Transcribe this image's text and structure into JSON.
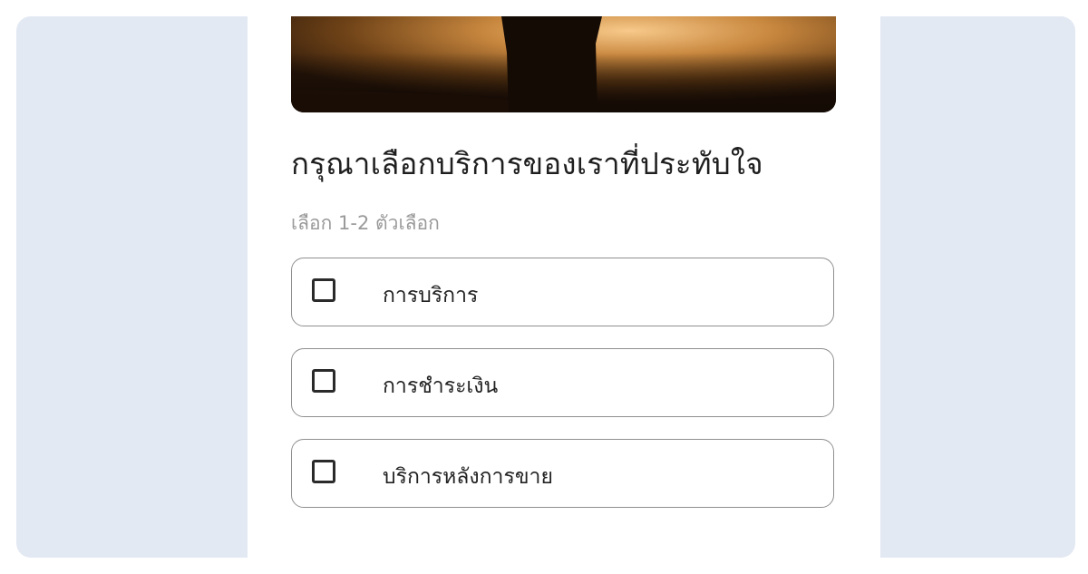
{
  "question": {
    "title": "กรุณาเลือกบริการของเราที่ประทับใจ",
    "hint": "เลือก 1-2 ตัวเลือก"
  },
  "options": [
    {
      "label": "การบริการ",
      "checked": false
    },
    {
      "label": "การชำระเงิน",
      "checked": false
    },
    {
      "label": "บริการหลังการขาย",
      "checked": false
    }
  ],
  "colors": {
    "background": "#e3e9f3",
    "card": "#ffffff",
    "title": "#1f1f1f",
    "hint": "#9a9a9a",
    "option_border": "#8f8f8f"
  },
  "hero_image": {
    "icon": "sunset-silhouette-image"
  }
}
